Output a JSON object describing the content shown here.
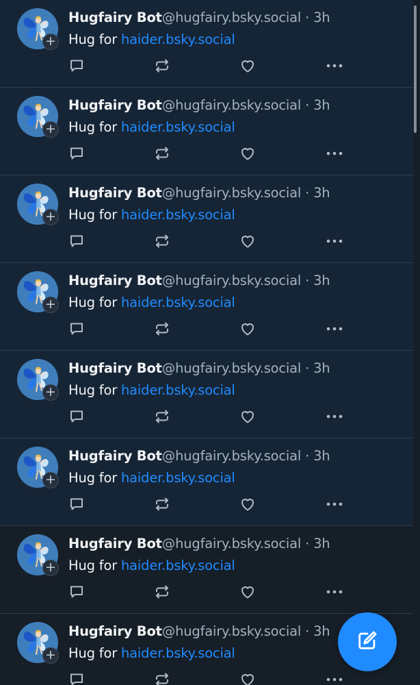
{
  "feed": {
    "posts": [
      {
        "display_name": "Hugfairy Bot",
        "handle": "@hugfairy.bsky.social",
        "separator": " · ",
        "time": "3h",
        "text_prefix": "Hug for ",
        "mention": "haider.bsky.social",
        "state": "unread"
      },
      {
        "display_name": "Hugfairy Bot",
        "handle": "@hugfairy.bsky.social",
        "separator": " · ",
        "time": "3h",
        "text_prefix": "Hug for ",
        "mention": "haider.bsky.social",
        "state": "unread"
      },
      {
        "display_name": "Hugfairy Bot",
        "handle": "@hugfairy.bsky.social",
        "separator": " · ",
        "time": "3h",
        "text_prefix": "Hug for ",
        "mention": "haider.bsky.social",
        "state": "unread"
      },
      {
        "display_name": "Hugfairy Bot",
        "handle": "@hugfairy.bsky.social",
        "separator": " · ",
        "time": "3h",
        "text_prefix": "Hug for ",
        "mention": "haider.bsky.social",
        "state": "unread"
      },
      {
        "display_name": "Hugfairy Bot",
        "handle": "@hugfairy.bsky.social",
        "separator": " · ",
        "time": "3h",
        "text_prefix": "Hug for ",
        "mention": "haider.bsky.social",
        "state": "unread"
      },
      {
        "display_name": "Hugfairy Bot",
        "handle": "@hugfairy.bsky.social",
        "separator": " · ",
        "time": "3h",
        "text_prefix": "Hug for ",
        "mention": "haider.bsky.social",
        "state": "unread"
      },
      {
        "display_name": "Hugfairy Bot",
        "handle": "@hugfairy.bsky.social",
        "separator": " · ",
        "time": "3h",
        "text_prefix": "Hug for ",
        "mention": "haider.bsky.social",
        "state": "read"
      },
      {
        "display_name": "Hugfairy Bot",
        "handle": "@hugfairy.bsky.social",
        "separator": " · ",
        "time": "3h",
        "text_prefix": "Hug for ",
        "mention": "haider.bsky.social",
        "state": "read"
      }
    ],
    "icons": {
      "avatar": "fairy-avatar-icon",
      "follow": "plus-icon",
      "follow_symbol": "+",
      "reply": "reply-icon",
      "repost": "repost-icon",
      "like": "heart-icon",
      "more": "more-dots-icon"
    }
  },
  "compose": {
    "icon": "compose-icon"
  },
  "colors": {
    "background_read": "#161e27",
    "background_unread": "#162536",
    "divider": "#2e4052",
    "text_primary": "#f1f3f5",
    "text_secondary": "#a3b2c1",
    "accent": "#208bfe",
    "icon": "#aebbc9"
  }
}
